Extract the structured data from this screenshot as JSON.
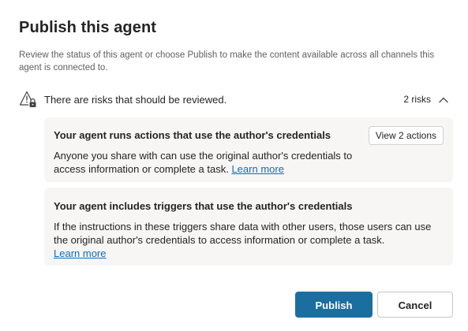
{
  "dialog": {
    "title": "Publish this agent",
    "description": "Review the status of this agent or choose Publish to make the content available across all channels this agent is connected to."
  },
  "risks": {
    "summary": "There are risks that should be reviewed.",
    "count_label": "2 risks",
    "icons": {
      "warning": "warning-lock-icon",
      "collapse": "chevron-up-icon"
    },
    "cards": [
      {
        "title": "Your agent runs actions that use the author's credentials",
        "body": "Anyone you share with can use the original author's credentials to access information or complete a task.",
        "link": "Learn more",
        "action_button": "View 2 actions"
      },
      {
        "title": "Your agent includes triggers that use the author's credentials",
        "body": "If the instructions in these triggers share data with other users, those users can use the original author's credentials to access information or complete a task.",
        "link": "Learn more"
      }
    ]
  },
  "footer": {
    "publish_label": "Publish",
    "cancel_label": "Cancel"
  },
  "colors": {
    "primary": "#1a6fa0",
    "link": "#0f6cbd",
    "card_bg": "#f7f6f5"
  }
}
